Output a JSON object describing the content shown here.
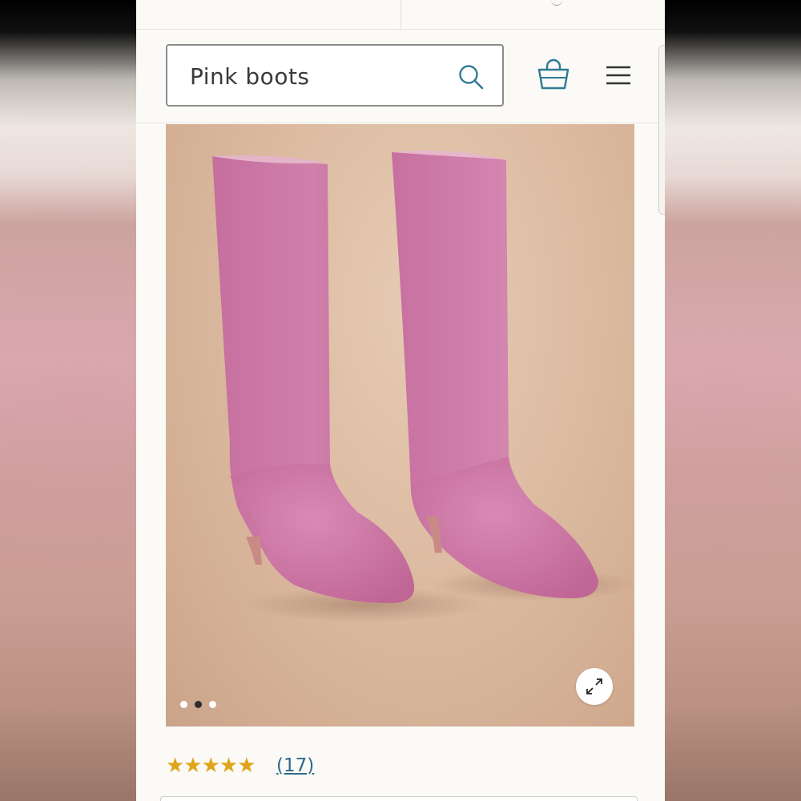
{
  "search": {
    "value": "Pink boots",
    "placeholder": ""
  },
  "icons": {
    "search": "search-icon",
    "bag": "shopping-bag-icon",
    "menu": "hamburger-menu-icon",
    "zoom": "expand-icon"
  },
  "colors": {
    "accent": "#2f7a94",
    "stars": "#e0a41a",
    "link": "#2f6a8a"
  },
  "gallery": {
    "image_count": 3,
    "active_index": 1
  },
  "rating": {
    "stars_text": "★★★★★",
    "value": 5,
    "out_of": 5,
    "review_count_label": "(17)"
  }
}
